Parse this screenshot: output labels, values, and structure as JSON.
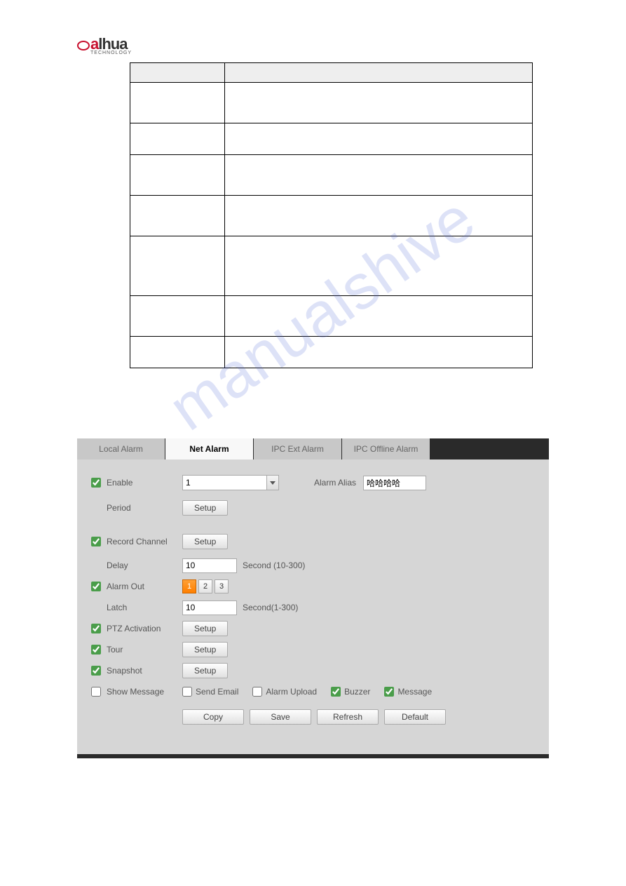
{
  "logo": {
    "brand": "alhua",
    "sub": "TECHNOLOGY"
  },
  "table": {
    "headers": [
      "",
      ""
    ],
    "rows": [
      {
        "h": "row-md",
        "cells": [
          "",
          ""
        ]
      },
      {
        "h": "row-sm",
        "cells": [
          "",
          ""
        ]
      },
      {
        "h": "row-md",
        "cells": [
          "",
          ""
        ]
      },
      {
        "h": "row-md",
        "cells": [
          "",
          ""
        ]
      },
      {
        "h": "row-lg",
        "cells": [
          "",
          ""
        ]
      },
      {
        "h": "row-md",
        "cells": [
          "",
          ""
        ]
      },
      {
        "h": "row-sm",
        "cells": [
          "",
          ""
        ]
      }
    ]
  },
  "tabs": [
    "Local Alarm",
    "Net Alarm",
    "IPC Ext Alarm",
    "IPC Offline Alarm"
  ],
  "activeTab": 1,
  "form": {
    "enable": {
      "label": "Enable",
      "checked": true,
      "channel": "1"
    },
    "alias": {
      "label": "Alarm Alias",
      "value": "哈哈哈哈"
    },
    "period": {
      "label": "Period",
      "btn": "Setup"
    },
    "record": {
      "label": "Record Channel",
      "checked": true,
      "btn": "Setup"
    },
    "delay": {
      "label": "Delay",
      "value": "10",
      "unit": "Second (10-300)"
    },
    "alarmOut": {
      "label": "Alarm Out",
      "checked": true,
      "options": [
        "1",
        "2",
        "3"
      ],
      "selected": 0
    },
    "latch": {
      "label": "Latch",
      "value": "10",
      "unit": "Second(1-300)"
    },
    "ptz": {
      "label": "PTZ Activation",
      "checked": true,
      "btn": "Setup"
    },
    "tour": {
      "label": "Tour",
      "checked": true,
      "btn": "Setup"
    },
    "snapshot": {
      "label": "Snapshot",
      "checked": true,
      "btn": "Setup"
    },
    "message": {
      "label": "Show Message",
      "checked": false
    },
    "opts": {
      "email": {
        "label": "Send Email",
        "checked": false
      },
      "upload": {
        "label": "Alarm Upload",
        "checked": false
      },
      "buzzer": {
        "label": "Buzzer",
        "checked": true
      },
      "msg": {
        "label": "Message",
        "checked": true
      }
    },
    "buttons": {
      "copy": "Copy",
      "save": "Save",
      "refresh": "Refresh",
      "default": "Default"
    }
  }
}
